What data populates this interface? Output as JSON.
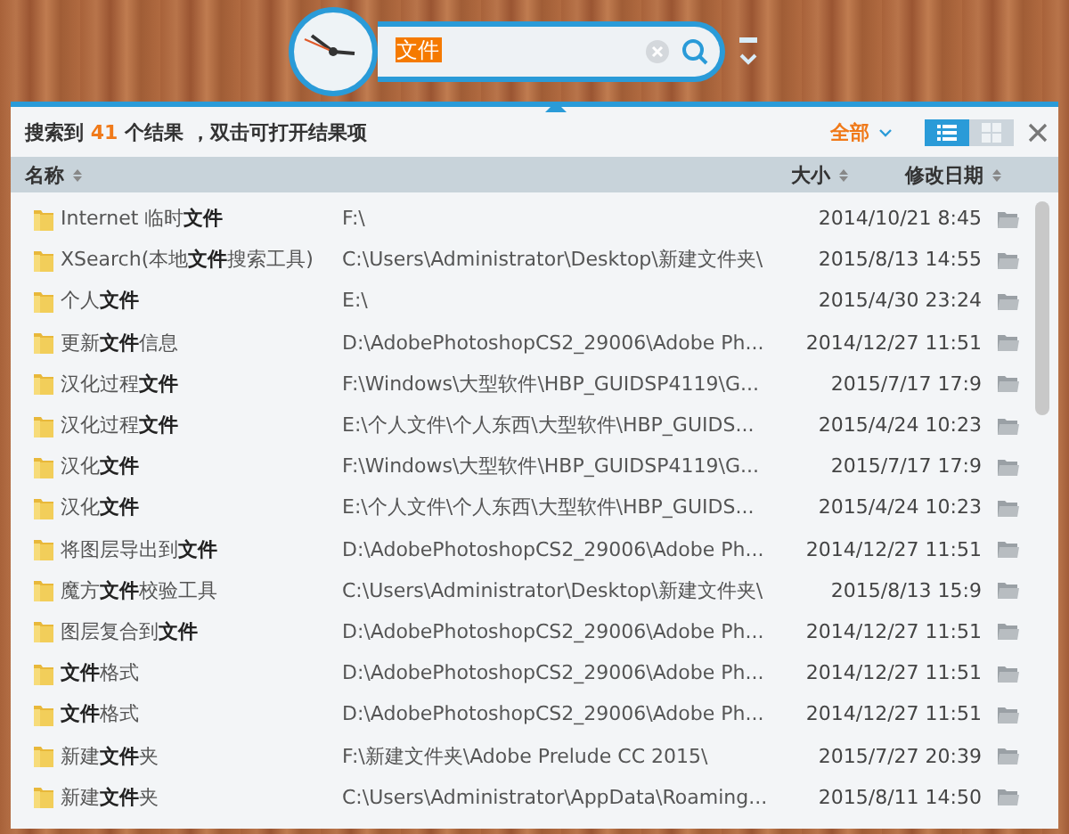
{
  "search": {
    "value": "文件"
  },
  "summary": {
    "prefix": "搜索到",
    "count": "41",
    "suffix": "个结果 ，双击可打开结果项"
  },
  "filter": {
    "label": "全部"
  },
  "view_buttons": [
    {
      "kind": "list",
      "selected": true
    },
    {
      "kind": "grid",
      "selected": false
    }
  ],
  "table": {
    "columns": [
      "名称",
      "大小",
      "修改日期"
    ],
    "rows": [
      {
        "name": "Internet 临时**文件**",
        "path": "F:\\",
        "date": "2014/10/21 8:45"
      },
      {
        "name": "XSearch(本地**文件**搜索工具)",
        "path": "C:\\Users\\Administrator\\Desktop\\新建文件夹\\",
        "date": "2015/8/13 14:55"
      },
      {
        "name": "个人**文件**",
        "path": "E:\\",
        "date": "2015/4/30 23:24"
      },
      {
        "name": "更新**文件**信息",
        "path": "D:\\AdobePhotoshopCS2_29006\\Adobe Ph...",
        "date": "2014/12/27 11:51"
      },
      {
        "name": "汉化过程**文件**",
        "path": "F:\\Windows\\大型软件\\HBP_GUIDSP4119\\G...",
        "date": "2015/7/17 17:9"
      },
      {
        "name": "汉化过程**文件**",
        "path": "E:\\个人文件\\个人东西\\大型软件\\HBP_GUIDS...",
        "date": "2015/4/24 10:23"
      },
      {
        "name": "汉化**文件**",
        "path": "F:\\Windows\\大型软件\\HBP_GUIDSP4119\\G...",
        "date": "2015/7/17 17:9"
      },
      {
        "name": "汉化**文件**",
        "path": "E:\\个人文件\\个人东西\\大型软件\\HBP_GUIDS...",
        "date": "2015/4/24 10:23"
      },
      {
        "name": "将图层导出到**文件**",
        "path": "D:\\AdobePhotoshopCS2_29006\\Adobe Ph...",
        "date": "2014/12/27 11:51"
      },
      {
        "name": "魔方**文件**校验工具",
        "path": "C:\\Users\\Administrator\\Desktop\\新建文件夹\\",
        "date": "2015/8/13 15:9"
      },
      {
        "name": "图层复合到**文件**",
        "path": "D:\\AdobePhotoshopCS2_29006\\Adobe Ph...",
        "date": "2014/12/27 11:51"
      },
      {
        "name": "**文件**格式",
        "path": "D:\\AdobePhotoshopCS2_29006\\Adobe Ph...",
        "date": "2014/12/27 11:51"
      },
      {
        "name": "**文件**格式",
        "path": "D:\\AdobePhotoshopCS2_29006\\Adobe Ph...",
        "date": "2014/12/27 11:51"
      },
      {
        "name": "新建**文件**夹",
        "path": "F:\\新建文件夹\\Adobe Prelude CC 2015\\",
        "date": "2015/7/27 20:39"
      },
      {
        "name": "新建**文件**夹",
        "path": "C:\\Users\\Administrator\\AppData\\Roaming...",
        "date": "2015/8/11 14:50"
      }
    ]
  }
}
